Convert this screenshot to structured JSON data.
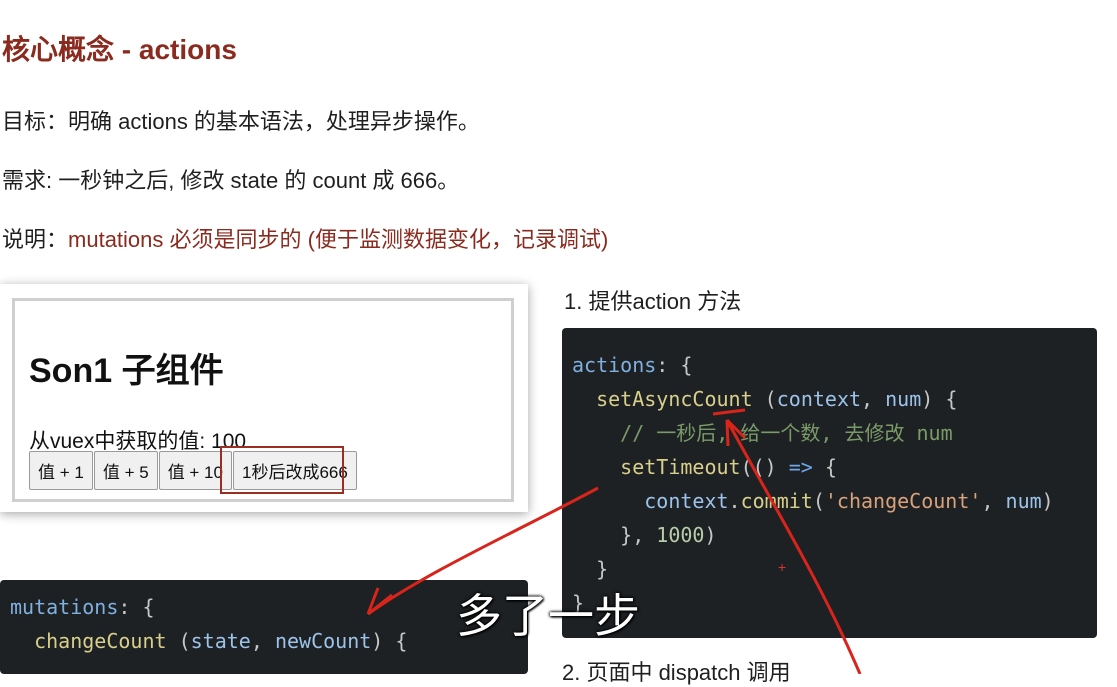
{
  "doc": {
    "title": "核心概念 - actions",
    "goal": "目标：明确 actions 的基本语法，处理异步操作。",
    "requirement": "需求: 一秒钟之后, 修改 state 的 count 成 666。",
    "note_prefix": "说明：",
    "note_highlight": "mutations 必须是同步的 (便于监测数据变化，记录调试)",
    "step1": "1. 提供action 方法",
    "step2": "2. 页面中 dispatch 调用"
  },
  "demo": {
    "component_title": "Son1 子组件",
    "value_label": "从vuex中获取的值: 100",
    "buttons": [
      "值 + 1",
      "值 + 5",
      "值 + 10",
      "1秒后改成666"
    ]
  },
  "code_actions": {
    "l1_key": "actions",
    "l1_rest": ": {",
    "l2_fn": "setAsyncCount",
    "l2_open": " (",
    "l2_arg1": "context",
    "l2_sep": ", ",
    "l2_arg2": "num",
    "l2_close": ") {",
    "l3_comment": "// 一秒后, 给一个数, 去修改 num",
    "l4_fn": "setTimeout",
    "l4_open": "(() ",
    "l4_arrow": "=>",
    "l4_close": " {",
    "l5_obj": "context",
    "l5_dot": ".",
    "l5_fn": "commit",
    "l5_open": "(",
    "l5_str": "'changeCount'",
    "l5_sep": ", ",
    "l5_arg": "num",
    "l5_close": ")",
    "l6_close": "}, ",
    "l6_num": "1000",
    "l6_end": ")",
    "l7": "}",
    "l8": "}"
  },
  "code_mutations": {
    "l1_key": "mutations",
    "l1_rest": ": {",
    "l2_fn": "changeCount",
    "l2_open": " (",
    "l2_arg1": "state",
    "l2_sep": ", ",
    "l2_arg2": "newCount",
    "l2_close": ") {"
  },
  "annotation": "多了一步",
  "colors": {
    "heading": "#8b2a1e",
    "highlight_text": "#8b2a1e",
    "annotation_stroke": "#d9241b",
    "code_bg": "#1e2124"
  }
}
